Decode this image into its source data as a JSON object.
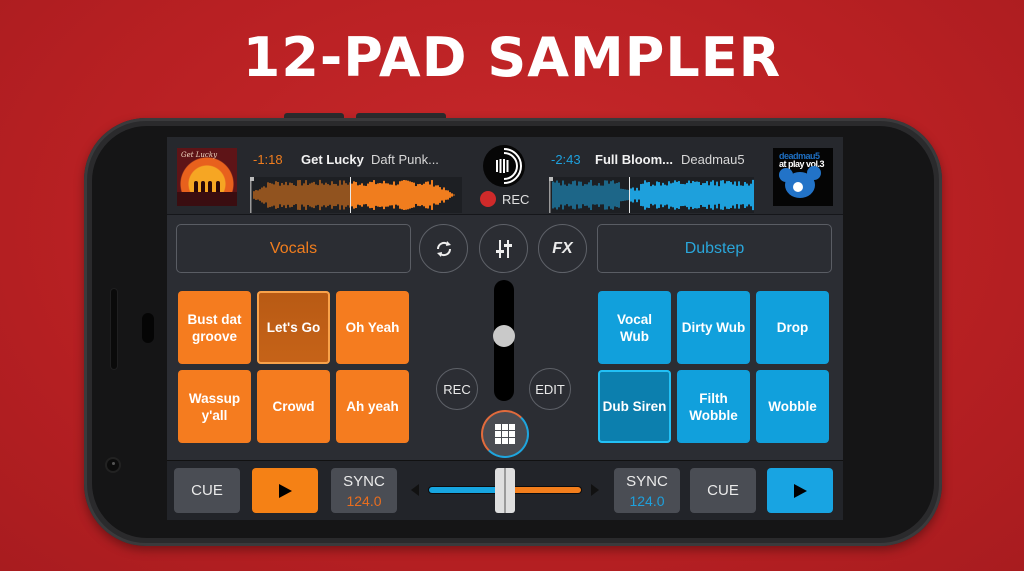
{
  "headline": "12-PAD SAMPLER",
  "deck_left": {
    "time_remaining": "-1:18",
    "title": "Get Lucky",
    "artist": "Daft Punk...",
    "cover_script": "Get Lucky",
    "color": "#f07d1e",
    "playhead_position": 0.47,
    "sample_bank": "Vocals",
    "pads": [
      {
        "label": "Bust dat groove",
        "active": false
      },
      {
        "label": "Let's Go",
        "active": true
      },
      {
        "label": "Oh Yeah",
        "active": false
      },
      {
        "label": "Wassup y'all",
        "active": false
      },
      {
        "label": "Crowd",
        "active": false
      },
      {
        "label": "Ah yeah",
        "active": false
      }
    ],
    "cue_label": "CUE",
    "sync_label": "SYNC",
    "bpm": "124.0"
  },
  "deck_right": {
    "time_remaining": "-2:43",
    "title": "Full Bloom...",
    "artist": "Deadmau5",
    "cover_line1": "deadmau5",
    "cover_line2": "at play vol.3",
    "color": "#1ea0dc",
    "playhead_position": 0.39,
    "sample_bank": "Dubstep",
    "pads": [
      {
        "label": "Vocal Wub",
        "active": false
      },
      {
        "label": "Dirty Wub",
        "active": false
      },
      {
        "label": "Drop",
        "active": false
      },
      {
        "label": "Dub Siren",
        "active": true
      },
      {
        "label": "Filth Wobble",
        "active": false
      },
      {
        "label": "Wobble",
        "active": false
      }
    ],
    "cue_label": "CUE",
    "sync_label": "SYNC",
    "bpm": "124.0"
  },
  "center": {
    "rec_label": "REC",
    "fx_label": "FX",
    "sampler_rec_label": "REC",
    "sampler_edit_label": "EDIT",
    "sampler_volume": 0.55,
    "crossfader_position": 0.5
  },
  "icons": {
    "sync": "sync-icon",
    "mixer": "mixer-sliders-icon",
    "fx": "fx-icon",
    "logo": "app-logo-icon",
    "grid": "pad-grid-icon",
    "play": "play-icon"
  }
}
